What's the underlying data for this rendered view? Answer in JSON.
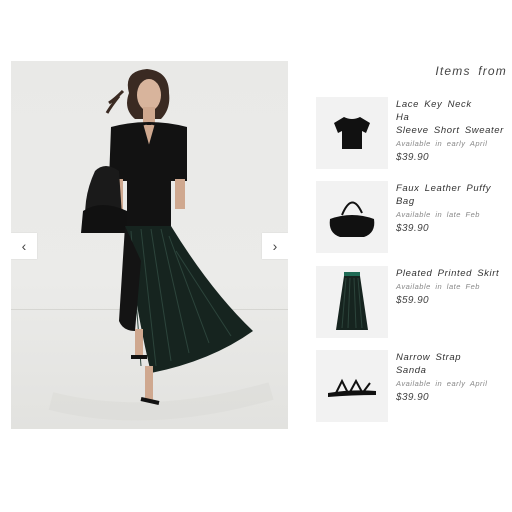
{
  "section": {
    "title": "Items from"
  },
  "carousel": {
    "prev_label": "‹",
    "next_label": "›"
  },
  "products": [
    {
      "name_lines": [
        "Lace Key Neck",
        "Ha",
        "Sleeve Short Sweater"
      ],
      "availability": "Available in early April",
      "price": "$39.90",
      "icon": "short-sleeve-top-icon"
    },
    {
      "name_lines": [
        "Faux Leather Puffy Bag"
      ],
      "availability": "Available in late Feb",
      "price": "$39.90",
      "icon": "shoulder-bag-icon"
    },
    {
      "name_lines": [
        "Pleated Printed Skirt"
      ],
      "availability": "Available in late Feb",
      "price": "$59.90",
      "icon": "pleated-skirt-icon"
    },
    {
      "name_lines": [
        "Narrow Strap",
        "Sanda"
      ],
      "availability": "Available in early April",
      "price": "$39.90",
      "icon": "strap-sandal-icon"
    }
  ],
  "colors": {
    "garment": "#111111",
    "skirt_accent": "#1f3a33",
    "thumb_bg": "#f2f2f2"
  }
}
